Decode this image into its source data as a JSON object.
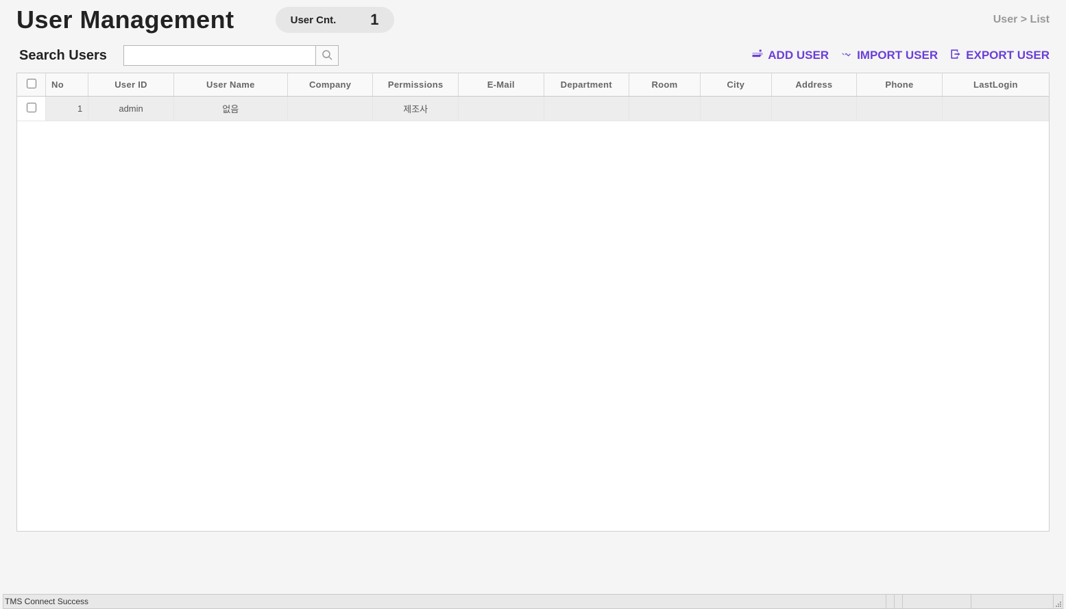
{
  "header": {
    "title": "User Management",
    "user_cnt_label": "User Cnt.",
    "user_cnt_value": "1",
    "breadcrumb": "User > List"
  },
  "search": {
    "label": "Search Users",
    "value": ""
  },
  "actions": {
    "add_user": "ADD USER",
    "import_user": "IMPORT USER",
    "export_user": "EXPORT USER"
  },
  "table": {
    "columns": {
      "no": "No",
      "user_id": "User ID",
      "user_name": "User Name",
      "company": "Company",
      "permissions": "Permissions",
      "email": "E-Mail",
      "department": "Department",
      "room": "Room",
      "city": "City",
      "address": "Address",
      "phone": "Phone",
      "last_login": "LastLogin"
    },
    "rows": [
      {
        "no": "1",
        "user_id": "admin",
        "user_name": "없음",
        "company": "",
        "permissions": "제조사",
        "email": "",
        "department": "",
        "room": "",
        "city": "",
        "address": "",
        "phone": "",
        "last_login": ""
      }
    ]
  },
  "status": {
    "text": "TMS Connect Success"
  }
}
